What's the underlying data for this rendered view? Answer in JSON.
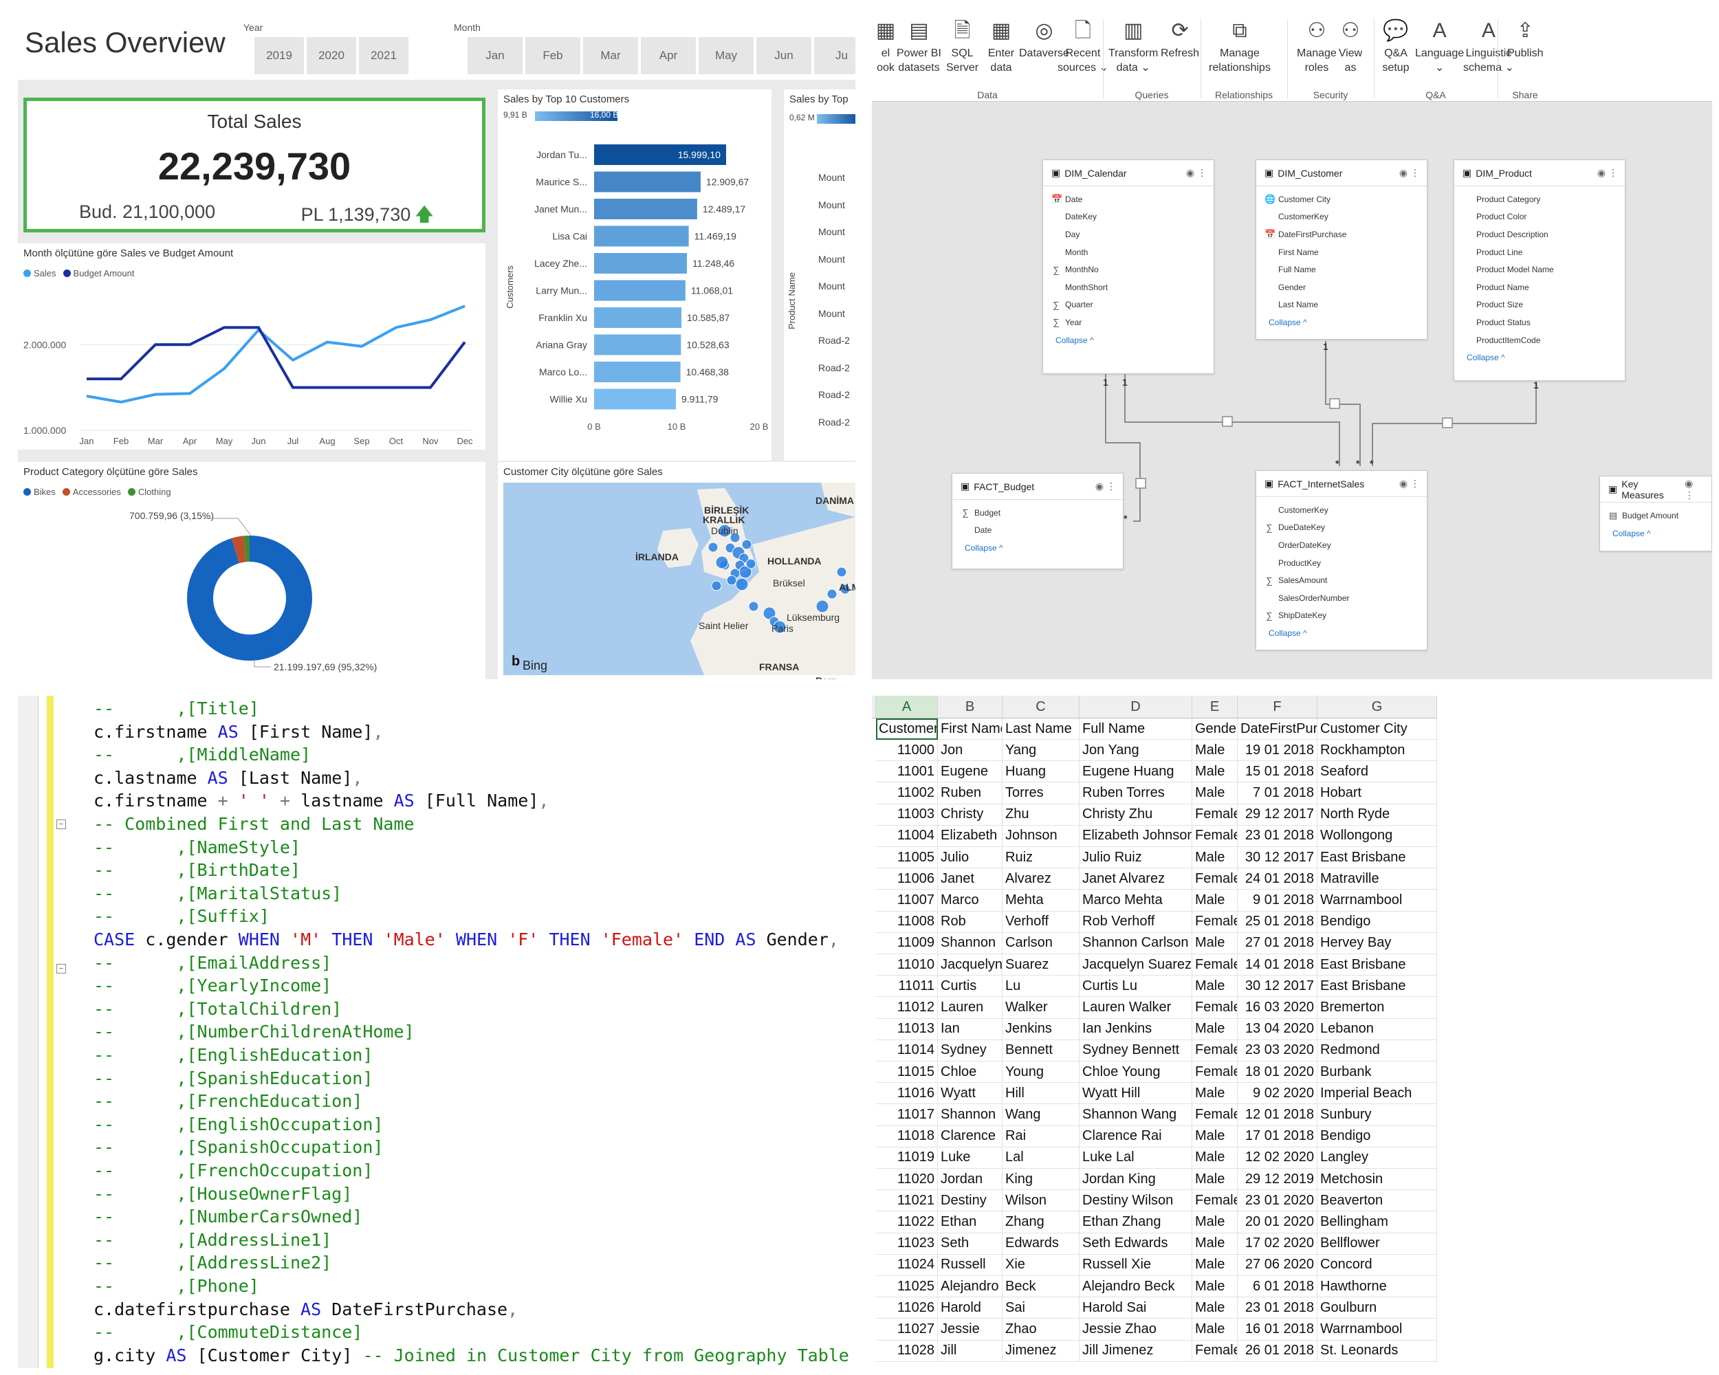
{
  "dashboard": {
    "title": "Sales Overview",
    "year_label": "Year",
    "years": [
      "2019",
      "2020",
      "2021"
    ],
    "month_label": "Month",
    "months": [
      "Jan",
      "Feb",
      "Mar",
      "Apr",
      "May",
      "Jun",
      "Ju"
    ],
    "kpi": {
      "title": "Total Sales",
      "value": "22,239,730",
      "budget": "Bud. 21,100,000",
      "pl": "PL 1,139,730"
    },
    "line_panel": {
      "title": "Month ölçütüne göre Sales ve Budget Amount",
      "legend": [
        "Sales",
        "Budget Amount"
      ]
    },
    "customers_panel": {
      "title": "Sales by Top 10 Customers",
      "scale_min": "9,91 B",
      "scale_max": "16,00 B",
      "axis_title": "Customers"
    },
    "product_panel": {
      "title": "Sales by Top",
      "scale_min": "0,62 M",
      "axis_title": "Product Name",
      "labels": [
        "Mount",
        "Mount",
        "Mount",
        "Mount",
        "Mount",
        "Mount",
        "Road-2",
        "Road-2",
        "Road-2",
        "Road-2"
      ]
    },
    "donut_panel": {
      "title": "Product Category ölçütüne göre Sales",
      "legend": [
        "Bikes",
        "Accessories",
        "Clothing"
      ],
      "label_small": "700.759,96 (3,15%)",
      "label_big": "21.199.197,69 (95,32%)"
    },
    "map_panel": {
      "title": "Customer City ölçütüne göre Sales",
      "labels": [
        "BİRLEŞİK",
        "KRALLIK",
        "Dublin",
        "İRLANDA",
        "HOLLANDA",
        "DANİMA",
        "Brüksel",
        "ALM",
        "Lüksemburg",
        "Saint Helier",
        "Paris",
        "FRANSA",
        "Bern"
      ],
      "bing": "Bing"
    }
  },
  "chart_data": [
    {
      "type": "line",
      "title": "Month ölçütüne göre Sales ve Budget Amount",
      "xlabel": "Month",
      "ylabel": "",
      "categories": [
        "Jan",
        "Feb",
        "Mar",
        "Apr",
        "May",
        "Jun",
        "Jul",
        "Aug",
        "Sep",
        "Oct",
        "Nov",
        "Dec"
      ],
      "ylim": [
        1000000,
        2700000
      ],
      "yticks": [
        "1.000.000",
        "2.000.000"
      ],
      "series": [
        {
          "name": "Sales",
          "color": "#3ba0f0",
          "values": [
            1400000,
            1330000,
            1420000,
            1430000,
            1720000,
            2170000,
            1820000,
            2030000,
            1980000,
            2200000,
            2290000,
            2450000
          ]
        },
        {
          "name": "Budget Amount",
          "color": "#1b2fa0",
          "values": [
            1600000,
            1600000,
            2000000,
            2000000,
            2200000,
            2200000,
            1500000,
            1500000,
            1500000,
            1500000,
            1500000,
            2030000
          ]
        }
      ]
    },
    {
      "type": "bar",
      "title": "Sales by Top 10 Customers",
      "categories": [
        "Jordan Tu...",
        "Maurice S...",
        "Janet Mun...",
        "Lisa Cai",
        "Lacey Zhe...",
        "Larry Mun...",
        "Franklin Xu",
        "Ariana Gray",
        "Marco Lo...",
        "Willie Xu"
      ],
      "values": [
        15999.1,
        12909.67,
        12489.17,
        11469.19,
        11248.46,
        11068.01,
        10585.87,
        10528.63,
        10468.38,
        9911.79
      ],
      "value_labels": [
        "15.999,10",
        "12.909,67",
        "12.489,17",
        "11.469,19",
        "11.248,46",
        "11.068,01",
        "10.585,87",
        "10.528,63",
        "10.468,38",
        "9.911,79"
      ],
      "xlim": [
        0,
        20000
      ],
      "xticks": [
        "0 B",
        "10 B",
        "20 B"
      ],
      "ylabel": "Customers"
    },
    {
      "type": "pie",
      "title": "Product Category ölçütüne göre Sales",
      "categories": [
        "Bikes",
        "Accessories",
        "Clothing"
      ],
      "values": [
        95.32,
        3.15,
        1.53
      ],
      "colors": [
        "#1565c0",
        "#c0502a",
        "#3f8f2f"
      ]
    }
  ],
  "ribbon": {
    "buttons": [
      {
        "label": "el\nook",
        "icon": "excel-icon"
      },
      {
        "label": "Power BI\ndatasets",
        "icon": "dataset-icon"
      },
      {
        "label": "SQL\nServer",
        "icon": "sql-icon"
      },
      {
        "label": "Enter\ndata",
        "icon": "table-icon"
      },
      {
        "label": "Dataverse",
        "icon": "dataverse-icon"
      },
      {
        "label": "Recent\nsources ⌄",
        "icon": "recent-icon"
      },
      {
        "label": "Transform\ndata ⌄",
        "icon": "transform-icon"
      },
      {
        "label": "Refresh",
        "icon": "refresh-icon"
      },
      {
        "label": "Manage\nrelationships",
        "icon": "relationships-icon"
      },
      {
        "label": "Manage\nroles",
        "icon": "roles-icon"
      },
      {
        "label": "View\nas",
        "icon": "view-as-icon"
      },
      {
        "label": "Q&A\nsetup",
        "icon": "qa-icon"
      },
      {
        "label": "Language\n⌄",
        "icon": "language-icon"
      },
      {
        "label": "Linguistic\nschema ⌄",
        "icon": "linguistic-icon"
      },
      {
        "label": "Publish",
        "icon": "publish-icon"
      }
    ],
    "groups": [
      "Data",
      "Queries",
      "Relationships",
      "Security",
      "Q&A",
      "Share"
    ]
  },
  "model": {
    "tables": [
      {
        "name": "DIM_Calendar",
        "fields": [
          "Date",
          "DateKey",
          "Day",
          "Month",
          "MonthNo",
          "MonthShort",
          "Quarter",
          "Year"
        ],
        "collapse": "Collapse ^"
      },
      {
        "name": "DIM_Customer",
        "fields": [
          "Customer City",
          "CustomerKey",
          "DateFirstPurchase",
          "First Name",
          "Full Name",
          "Gender",
          "Last Name"
        ],
        "collapse": "Collapse ^"
      },
      {
        "name": "DIM_Product",
        "fields": [
          "Product Category",
          "Product Color",
          "Product Description",
          "Product Line",
          "Product Model Name",
          "Product Name",
          "Product Size",
          "Product Status",
          "ProductItemCode"
        ],
        "collapse": "Collapse ^"
      },
      {
        "name": "FACT_Budget",
        "fields": [
          "Budget",
          "Date"
        ],
        "collapse": "Collapse ^"
      },
      {
        "name": "FACT_InternetSales",
        "fields": [
          "CustomerKey",
          "DueDateKey",
          "OrderDateKey",
          "ProductKey",
          "SalesAmount",
          "SalesOrderNumber",
          "ShipDateKey"
        ],
        "collapse": "Collapse ^"
      },
      {
        "name": "Key Measures",
        "fields": [
          "Budget Amount"
        ],
        "collapse": "Collapse ^"
      }
    ]
  },
  "sql": {
    "lines": [
      "--      ,[Title]",
      "c.firstname AS [First Name],",
      "--      ,[MiddleName]",
      "c.lastname AS [Last Name],",
      "c.firstname + ' ' + lastname AS [Full Name],",
      "-- Combined First and Last Name",
      "--      ,[NameStyle]",
      "--      ,[BirthDate]",
      "--      ,[MaritalStatus]",
      "--      ,[Suffix]",
      "CASE c.gender WHEN 'M' THEN 'Male' WHEN 'F' THEN 'Female' END AS Gender,",
      "--      ,[EmailAddress]",
      "--      ,[YearlyIncome]",
      "--      ,[TotalChildren]",
      "--      ,[NumberChildrenAtHome]",
      "--      ,[EnglishEducation]",
      "--      ,[SpanishEducation]",
      "--      ,[FrenchEducation]",
      "--      ,[EnglishOccupation]",
      "--      ,[SpanishOccupation]",
      "--      ,[FrenchOccupation]",
      "--      ,[HouseOwnerFlag]",
      "--      ,[NumberCarsOwned]",
      "--      ,[AddressLine1]",
      "--      ,[AddressLine2]",
      "--      ,[Phone]",
      "c.datefirstpurchase AS DateFirstPurchase,",
      "--      ,[CommuteDistance]",
      "g.city AS [Customer City] -- Joined in Customer City from Geography Table"
    ]
  },
  "sheet": {
    "col_letters": [
      "A",
      "B",
      "C",
      "D",
      "E",
      "F",
      "G"
    ],
    "headers": [
      "CustomerKey",
      "First Name",
      "Last Name",
      "Full Name",
      "Gender",
      "DateFirstPurchase",
      "Customer City"
    ],
    "rows": [
      [
        "11000",
        "Jon",
        "Yang",
        "Jon Yang",
        "Male",
        "19 01 2018",
        "Rockhampton"
      ],
      [
        "11001",
        "Eugene",
        "Huang",
        "Eugene Huang",
        "Male",
        "15 01 2018",
        "Seaford"
      ],
      [
        "11002",
        "Ruben",
        "Torres",
        "Ruben Torres",
        "Male",
        "7 01 2018",
        "Hobart"
      ],
      [
        "11003",
        "Christy",
        "Zhu",
        "Christy Zhu",
        "Female",
        "29 12 2017",
        "North Ryde"
      ],
      [
        "11004",
        "Elizabeth",
        "Johnson",
        "Elizabeth Johnson",
        "Female",
        "23 01 2018",
        "Wollongong"
      ],
      [
        "11005",
        "Julio",
        "Ruiz",
        "Julio Ruiz",
        "Male",
        "30 12 2017",
        "East Brisbane"
      ],
      [
        "11006",
        "Janet",
        "Alvarez",
        "Janet Alvarez",
        "Female",
        "24 01 2018",
        "Matraville"
      ],
      [
        "11007",
        "Marco",
        "Mehta",
        "Marco Mehta",
        "Male",
        "9 01 2018",
        "Warrnambool"
      ],
      [
        "11008",
        "Rob",
        "Verhoff",
        "Rob Verhoff",
        "Female",
        "25 01 2018",
        "Bendigo"
      ],
      [
        "11009",
        "Shannon",
        "Carlson",
        "Shannon Carlson",
        "Male",
        "27 01 2018",
        "Hervey Bay"
      ],
      [
        "11010",
        "Jacquelyn",
        "Suarez",
        "Jacquelyn Suarez",
        "Female",
        "14 01 2018",
        "East Brisbane"
      ],
      [
        "11011",
        "Curtis",
        "Lu",
        "Curtis Lu",
        "Male",
        "30 12 2017",
        "East Brisbane"
      ],
      [
        "11012",
        "Lauren",
        "Walker",
        "Lauren Walker",
        "Female",
        "16 03 2020",
        "Bremerton"
      ],
      [
        "11013",
        "Ian",
        "Jenkins",
        "Ian Jenkins",
        "Male",
        "13 04 2020",
        "Lebanon"
      ],
      [
        "11014",
        "Sydney",
        "Bennett",
        "Sydney Bennett",
        "Female",
        "23 03 2020",
        "Redmond"
      ],
      [
        "11015",
        "Chloe",
        "Young",
        "Chloe Young",
        "Female",
        "18 01 2020",
        "Burbank"
      ],
      [
        "11016",
        "Wyatt",
        "Hill",
        "Wyatt Hill",
        "Male",
        "9 02 2020",
        "Imperial Beach"
      ],
      [
        "11017",
        "Shannon",
        "Wang",
        "Shannon Wang",
        "Female",
        "12 01 2018",
        "Sunbury"
      ],
      [
        "11018",
        "Clarence",
        "Rai",
        "Clarence Rai",
        "Male",
        "17 01 2018",
        "Bendigo"
      ],
      [
        "11019",
        "Luke",
        "Lal",
        "Luke Lal",
        "Male",
        "12 02 2020",
        "Langley"
      ],
      [
        "11020",
        "Jordan",
        "King",
        "Jordan King",
        "Male",
        "29 12 2019",
        "Metchosin"
      ],
      [
        "11021",
        "Destiny",
        "Wilson",
        "Destiny Wilson",
        "Female",
        "23 01 2020",
        "Beaverton"
      ],
      [
        "11022",
        "Ethan",
        "Zhang",
        "Ethan Zhang",
        "Male",
        "20 01 2020",
        "Bellingham"
      ],
      [
        "11023",
        "Seth",
        "Edwards",
        "Seth Edwards",
        "Male",
        "17 02 2020",
        "Bellflower"
      ],
      [
        "11024",
        "Russell",
        "Xie",
        "Russell Xie",
        "Male",
        "27 06 2020",
        "Concord"
      ],
      [
        "11025",
        "Alejandro",
        "Beck",
        "Alejandro Beck",
        "Male",
        "6 01 2018",
        "Hawthorne"
      ],
      [
        "11026",
        "Harold",
        "Sai",
        "Harold Sai",
        "Male",
        "23 01 2018",
        "Goulburn"
      ],
      [
        "11027",
        "Jessie",
        "Zhao",
        "Jessie Zhao",
        "Male",
        "16 01 2018",
        "Warrnambool"
      ],
      [
        "11028",
        "Jill",
        "Jimenez",
        "Jill Jimenez",
        "Female",
        "26 01 2018",
        "St. Leonards"
      ]
    ]
  }
}
